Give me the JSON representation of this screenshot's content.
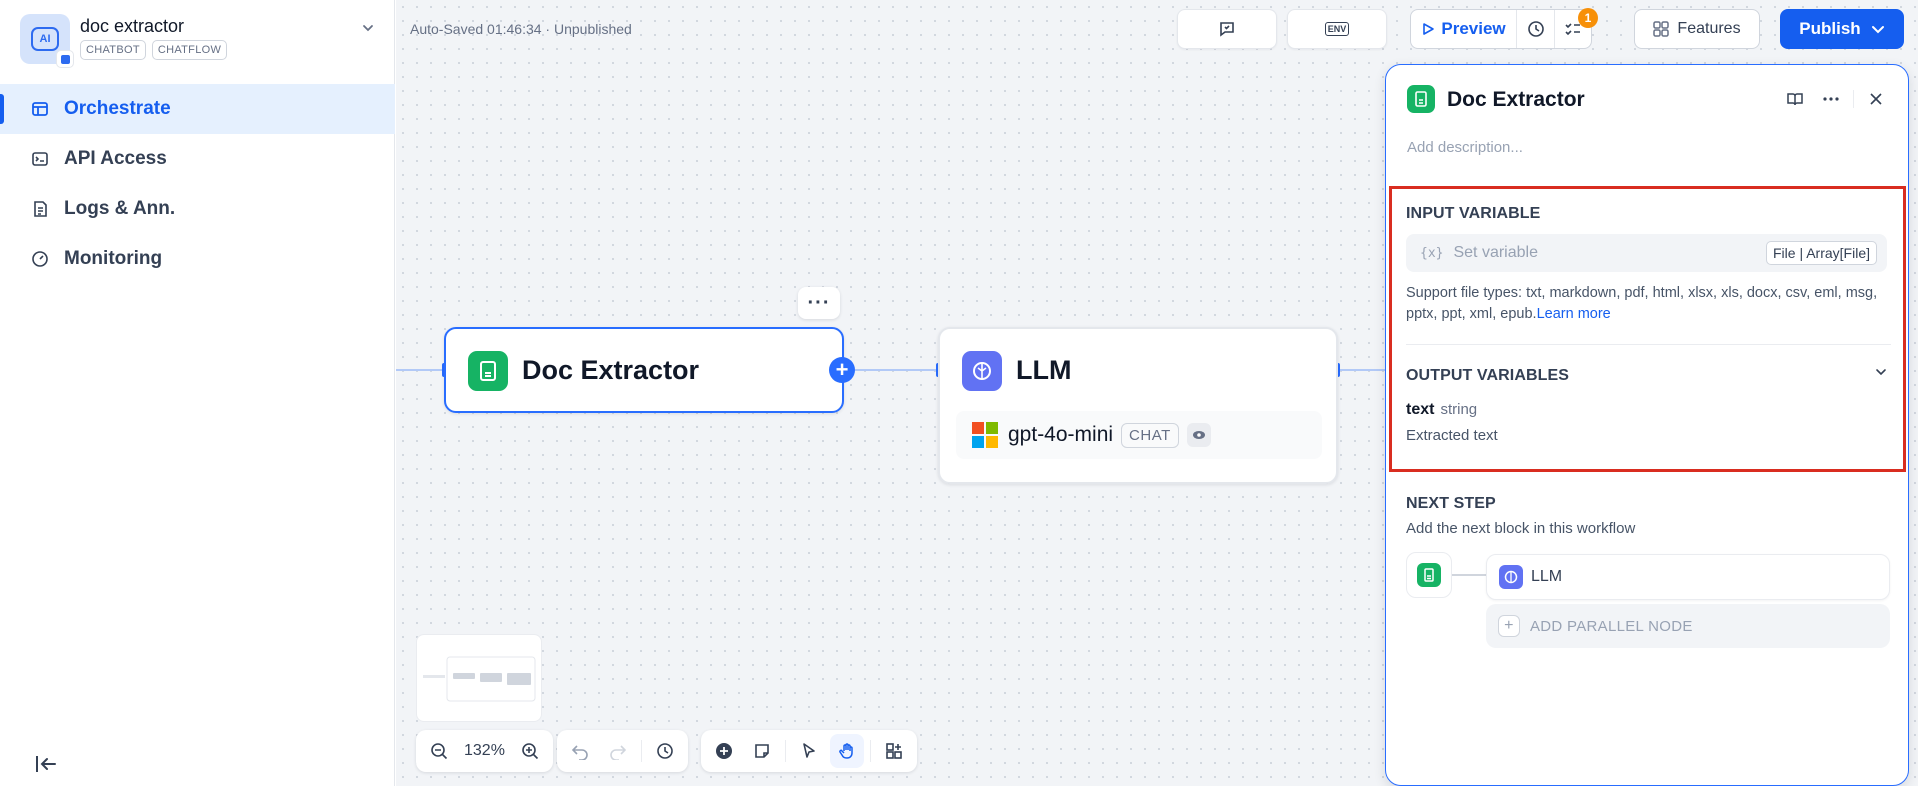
{
  "app": {
    "name": "doc extractor",
    "badges": [
      "CHATBOT",
      "CHATFLOW"
    ]
  },
  "nav": [
    {
      "label": "Orchestrate",
      "icon": "orchestrate-icon",
      "active": true
    },
    {
      "label": "API Access",
      "icon": "terminal-icon",
      "active": false
    },
    {
      "label": "Logs & Ann.",
      "icon": "logs-icon",
      "active": false
    },
    {
      "label": "Monitoring",
      "icon": "monitoring-icon",
      "active": false
    }
  ],
  "status": {
    "autosave": "Auto-Saved 01:46:34 · Unpublished"
  },
  "header": {
    "env_label": "ENV",
    "preview_label": "Preview",
    "notification_count": "1",
    "features_label": "Features",
    "publish_label": "Publish"
  },
  "canvas": {
    "zoom": "132%",
    "nodes": {
      "doc_extractor": {
        "title": "Doc Extractor"
      },
      "llm": {
        "title": "LLM",
        "model": "gpt-4o-mini",
        "model_tag": "CHAT"
      }
    }
  },
  "panel": {
    "title": "Doc Extractor",
    "description_placeholder": "Add description...",
    "input_section_title": "INPUT VARIABLE",
    "input_placeholder": "Set variable",
    "input_var_symbol": "{x}",
    "input_type": "File | Array[File]",
    "support_text": "Support file types: txt, markdown, pdf, html, xlsx, xls, docx, csv, eml, msg, pptx, ppt, xml, epub.",
    "learn_more": "Learn more",
    "output_section_title": "OUTPUT VARIABLES",
    "output_var_name": "text",
    "output_var_type": "string",
    "output_var_desc": "Extracted text",
    "next_step_title": "NEXT STEP",
    "next_step_subtitle": "Add the next block in this workflow",
    "next_node_label": "LLM",
    "add_parallel_label": "ADD PARALLEL NODE"
  },
  "colors": {
    "accent": "#155eef",
    "doc_node": "#16b364",
    "llm_node": "#6172f3",
    "highlight": "#d92d20"
  }
}
